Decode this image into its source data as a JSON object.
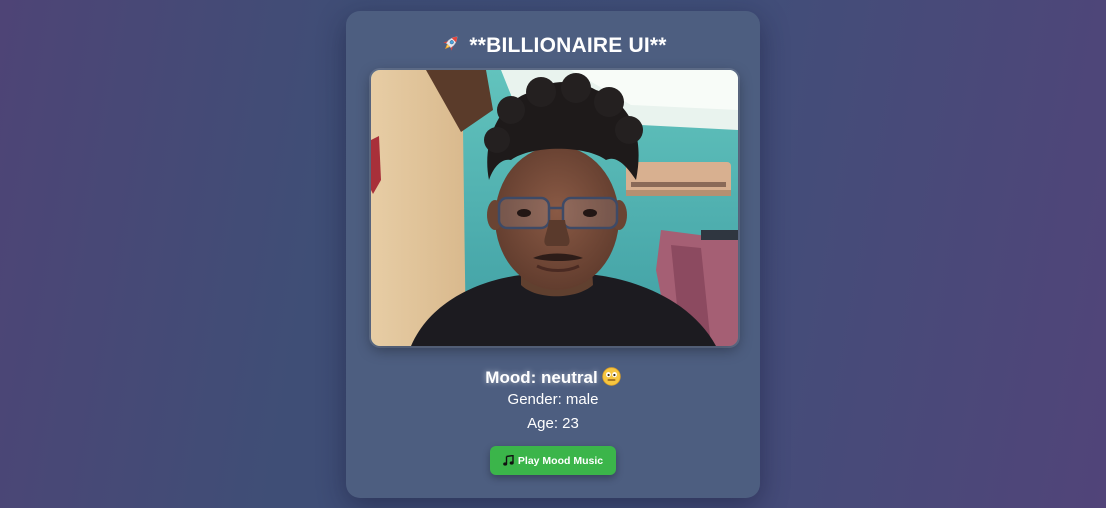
{
  "app": {
    "title": "**BILLIONAIRE UI**",
    "title_icon": "rocket-icon"
  },
  "camera": {
    "feed_icon": "webcam-feed"
  },
  "analysis": {
    "mood_text": "Mood: neutral",
    "mood_icon": "neutral-face-emoji-icon",
    "gender_text": "Gender: male",
    "age_text": "Age: 23"
  },
  "actions": {
    "play_label": "Play Mood Music",
    "play_icon": "music-note-icon",
    "play_color": "#3bb54a"
  },
  "colors": {
    "card": "#4d5e80",
    "accent": "#3bb54a",
    "text": "#ffffff"
  }
}
